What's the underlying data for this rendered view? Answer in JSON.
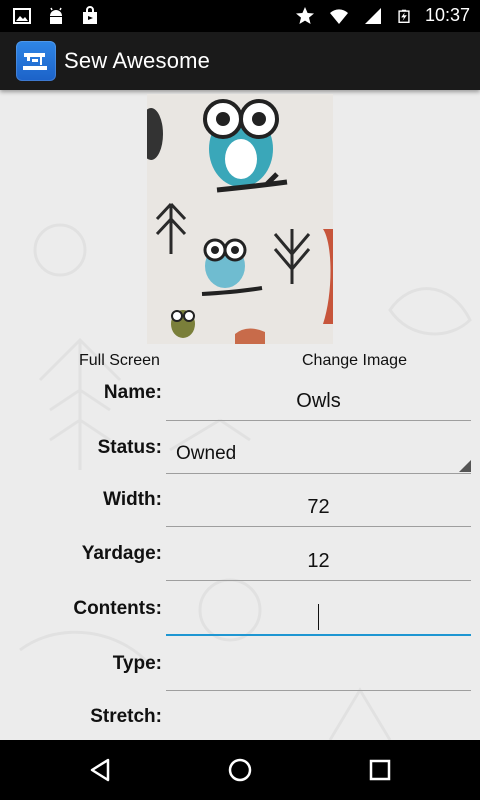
{
  "status_bar": {
    "time": "10:37",
    "left_icons": [
      "image-icon",
      "android-icon",
      "shopping-bag-icon"
    ],
    "right_icons": [
      "star-icon",
      "wifi-icon",
      "signal-icon",
      "battery-charging-icon"
    ]
  },
  "app": {
    "title": "Sew Awesome",
    "icon": "sewing-machine-icon",
    "brand_color": "#2a7fe0"
  },
  "photo_actions": {
    "full_screen": "Full Screen",
    "change_image": "Change Image"
  },
  "form": {
    "name": {
      "label": "Name:",
      "value": "Owls"
    },
    "status": {
      "label": "Status:",
      "value": "Owned"
    },
    "width": {
      "label": "Width:",
      "value": "72"
    },
    "yardage": {
      "label": "Yardage:",
      "value": "12"
    },
    "contents": {
      "label": "Contents:",
      "value": ""
    },
    "type": {
      "label": "Type:",
      "value": ""
    },
    "stretch": {
      "label": "Stretch:"
    }
  },
  "nav": {
    "back": "back-icon",
    "home": "home-icon",
    "recents": "recents-icon"
  },
  "colors": {
    "focus_underline": "#1e96d2",
    "status_bar": "#000000",
    "action_bar": "#1a1a1a"
  }
}
